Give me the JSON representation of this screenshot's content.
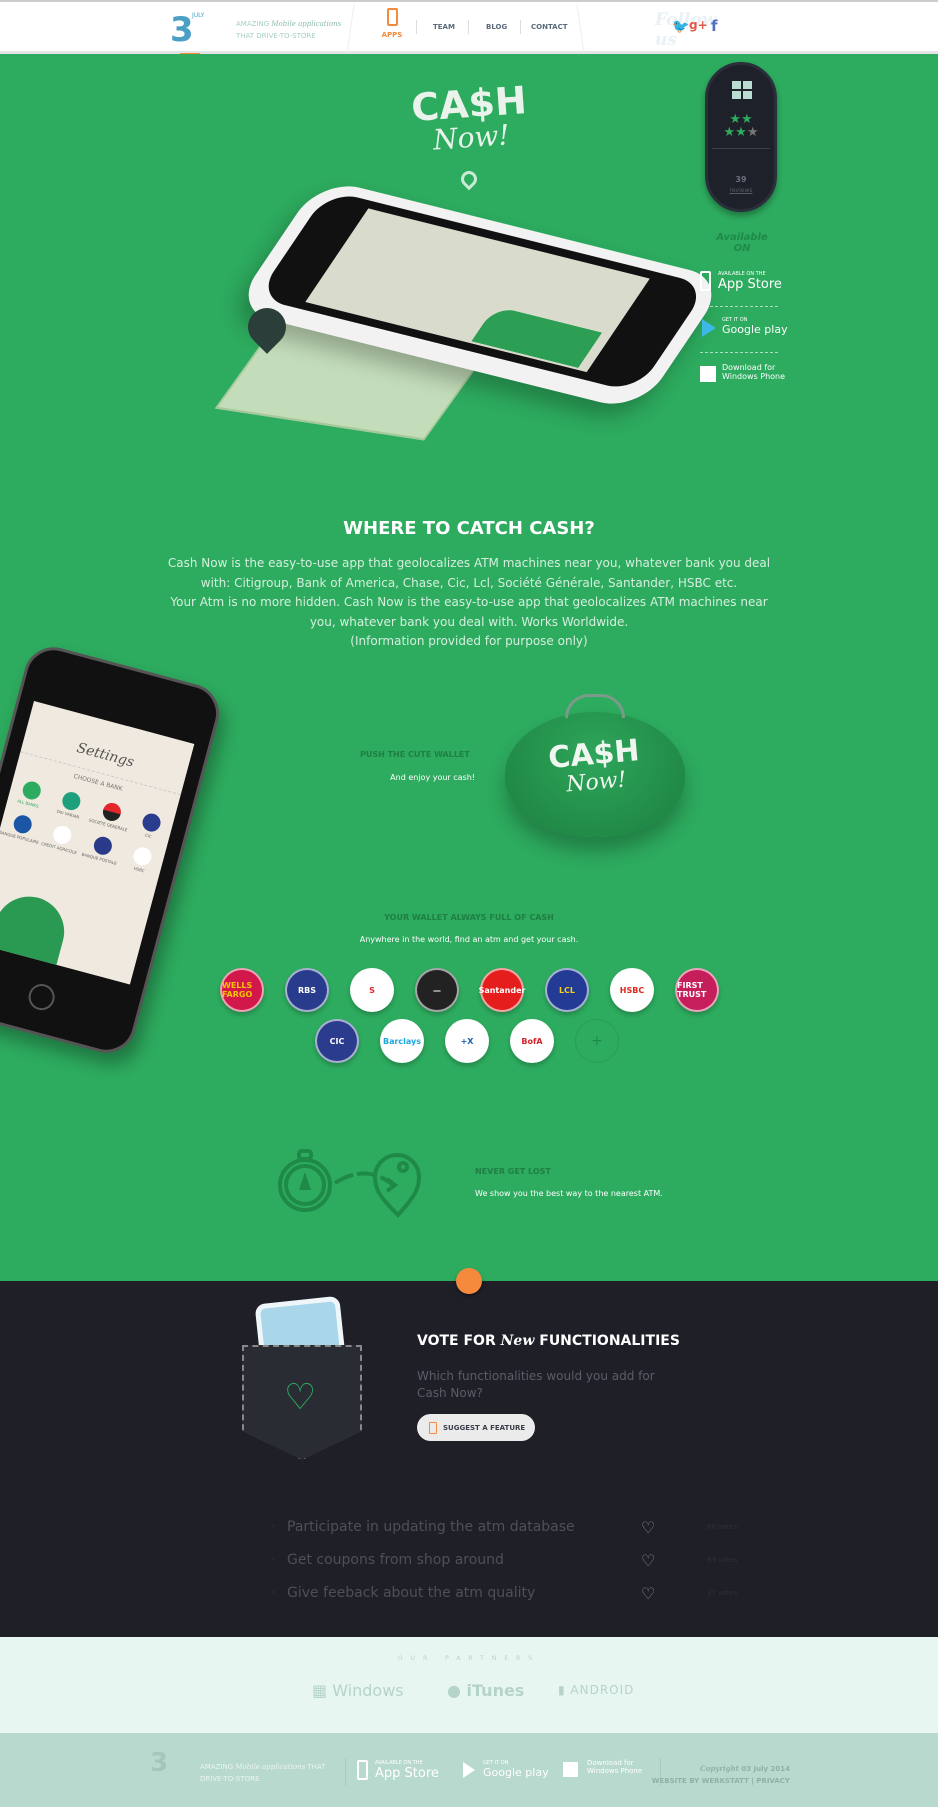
{
  "header": {
    "logo_day": "3",
    "logo_month": "JULY",
    "tagline_1": "AMAZING",
    "tagline_script": "Mobile applications",
    "tagline_2": "THAT DRIVE-TO-STORE",
    "nav": [
      {
        "label": "APPS",
        "active": true
      },
      {
        "label": "TEAM"
      },
      {
        "label": "BLOG"
      },
      {
        "label": "CONTACT"
      }
    ],
    "follow": "Follow us"
  },
  "hero": {
    "app_logo_line1": "CA$H",
    "app_logo_line2": "Now!",
    "rating": {
      "stars": 3.5,
      "max": 5,
      "reviews_count": "39",
      "reviews_label": "reviews"
    },
    "available_on": "Available ON",
    "stores": [
      {
        "small": "AVAILABLE ON THE",
        "big": "App Store"
      },
      {
        "small": "GET IT ON",
        "big": "Google play"
      },
      {
        "small": "Download for",
        "big": "Windows Phone"
      }
    ]
  },
  "intro": {
    "title": "WHERE TO CATCH CASH?",
    "lines": [
      "Cash Now is the easy-to-use app that geolocalizes ATM machines near you, whatever bank you deal",
      "with: Citigroup, Bank of America, Chase, Cic, Lcl, Société Générale, Santander, HSBC etc.",
      "Your Atm is no more hidden. Cash Now is the easy-to-use app that geolocalizes ATM machines near",
      "you, whatever bank you deal with. Works Worldwide.",
      "(Information provided for purpose only)"
    ]
  },
  "phone_screen": {
    "title": "Settings",
    "subtitle": "CHOOSE A BANK",
    "banks": [
      "ALL BANKS",
      "DIV VARIAN",
      "SOCIETE GENERALE",
      "CIC",
      "BANQUE POPULAIRE",
      "CREDIT AGRICOLE",
      "BANQUE POSTALE",
      "HSBC"
    ]
  },
  "wallet": {
    "title": "PUSH THE CUTE WALLET",
    "text": "And enjoy your cash!"
  },
  "banks_section": {
    "title": "YOUR WALLET ALWAYS FULL OF CASH",
    "text": "Anywhere in the world, find an atm and get your cash.",
    "banks": [
      {
        "name": "WELLS FARGO",
        "bg": "#d2174a",
        "fg": "#f6c500"
      },
      {
        "name": "RBS",
        "bg": "#283b8c",
        "fg": "#fff"
      },
      {
        "name": "S",
        "bg": "#fff",
        "fg": "#e3262b"
      },
      {
        "name": "—",
        "bg": "#222",
        "fg": "#fff"
      },
      {
        "name": "Santander",
        "bg": "#e51d1d",
        "fg": "#fff"
      },
      {
        "name": "LCL",
        "bg": "#233b94",
        "fg": "#f3d11b"
      },
      {
        "name": "HSBC",
        "bg": "#fff",
        "fg": "#e2261d"
      },
      {
        "name": "FIRST TRUST",
        "bg": "#c51e5a",
        "fg": "#fff"
      },
      {
        "name": "CIC",
        "bg": "#2b3b8d",
        "fg": "#fff"
      },
      {
        "name": "Barclays",
        "bg": "#fff",
        "fg": "#1ba6e0"
      },
      {
        "name": "+X",
        "bg": "#fff",
        "fg": "#1b5fb0"
      },
      {
        "name": "BofA",
        "bg": "#fff",
        "fg": "#d2232a"
      }
    ],
    "more": "+"
  },
  "navigate": {
    "title": "NEVER GET LOST",
    "text": "We show you the best way to the nearest ATM."
  },
  "vote": {
    "title_1": "VOTE FOR",
    "title_script": "New",
    "title_2": "FUNCTIONALITIES",
    "text": "Which functionalities would you add for Cash Now?",
    "button": "SUGGEST A FEATURE",
    "items": [
      {
        "label": "Participate in updating the atm database",
        "votes": "66 votes"
      },
      {
        "label": "Get coupons from shop around",
        "votes": "63 votes"
      },
      {
        "label": "Give feeback about the atm quality",
        "votes": "37 votes"
      }
    ]
  },
  "partners": {
    "title": "OUR PARTNERS",
    "items": [
      "Windows",
      "iTunes",
      "ANDROID"
    ]
  },
  "footer": {
    "tagline_1": "AMAZING",
    "tagline_script": "Mobile applications",
    "tagline_2": "THAT DRIVE-TO-STORE",
    "stores": [
      {
        "small": "AVAILABLE ON THE",
        "big": "App Store"
      },
      {
        "small": "GET IT ON",
        "big": "Google play"
      },
      {
        "small": "Download for",
        "big": "Windows Phone"
      }
    ],
    "copyright_script": "Copyright",
    "copyright": "03 July 2014",
    "credit": "WEBSITE BY WERKSTATT",
    "privacy": "PRIVACY"
  },
  "colors": {
    "green": "#2dab5e",
    "dark": "#1e1f27",
    "orange": "#f58a3c"
  }
}
